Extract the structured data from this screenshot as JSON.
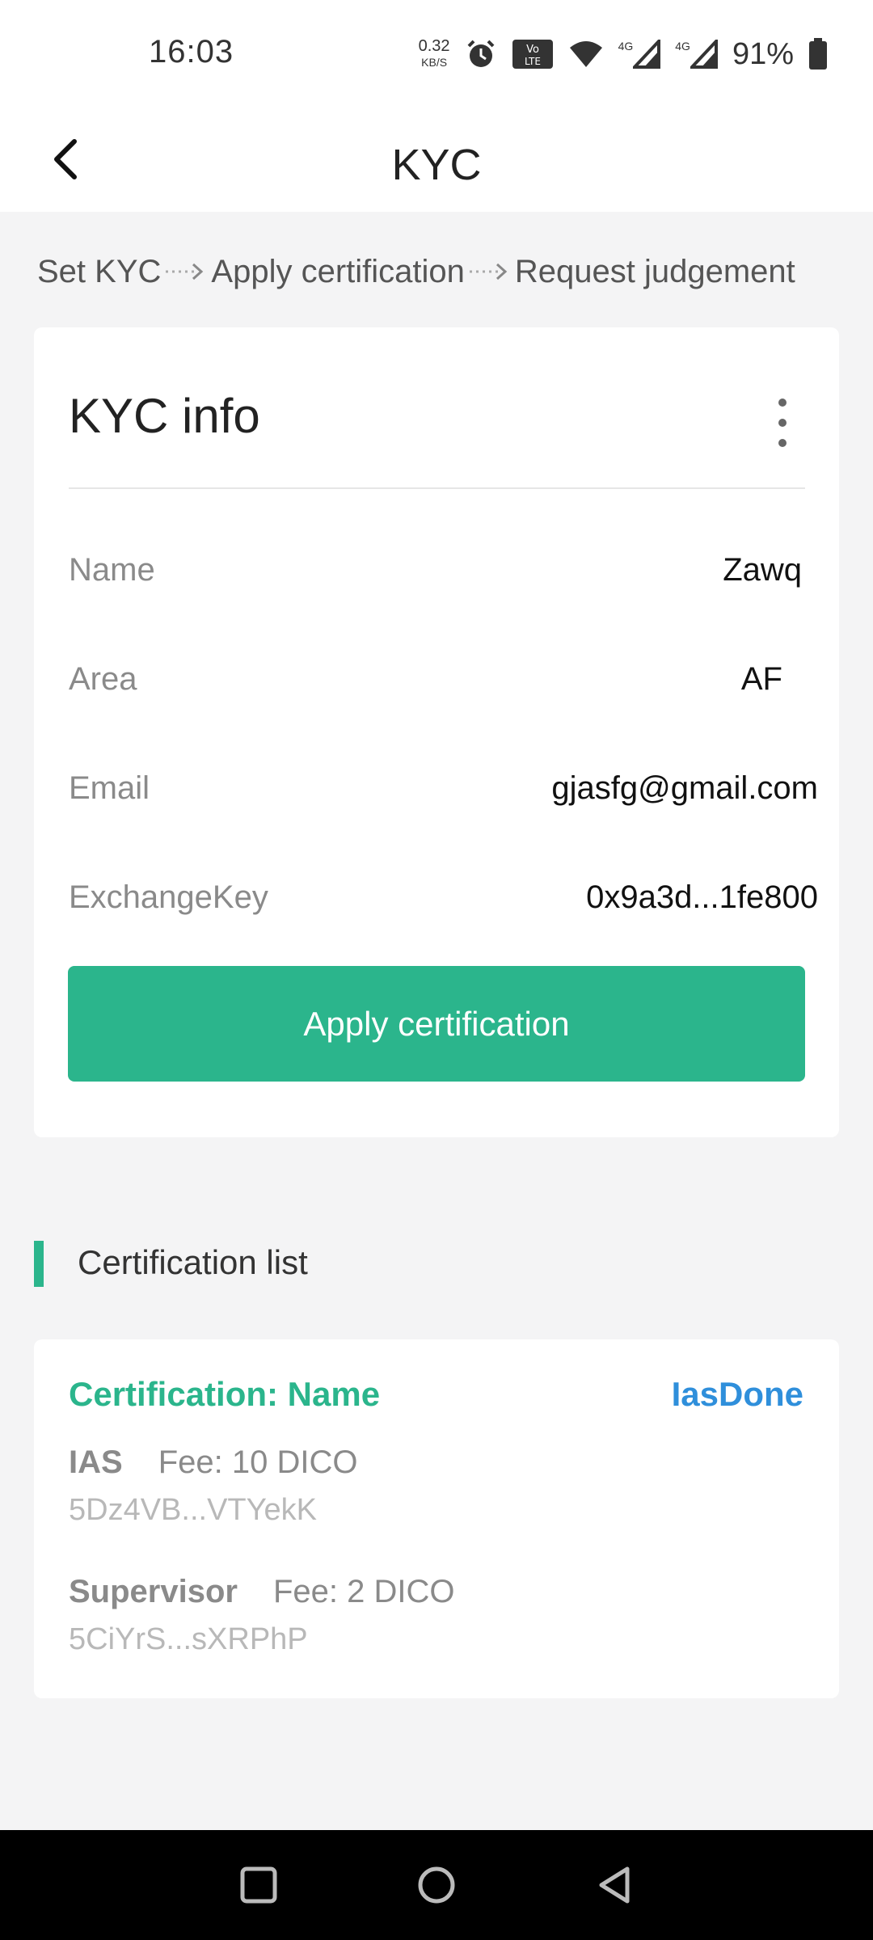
{
  "status_bar": {
    "time": "16:03",
    "net_speed_value": "0.32",
    "net_speed_unit": "KB/S",
    "signal_1": "4G",
    "signal_2": "4G",
    "battery_percent": "91%"
  },
  "app_bar": {
    "title": "KYC"
  },
  "steps": [
    "Set KYC",
    "Apply certification",
    "Request judgement"
  ],
  "kyc_card": {
    "title": "KYC info",
    "rows": [
      {
        "label": "Name",
        "value": "Zawq"
      },
      {
        "label": "Area",
        "value": "AF"
      },
      {
        "label": "Email",
        "value": "gjasfg@gmail.com"
      },
      {
        "label": "ExchangeKey",
        "value": "0x9a3d...1fe800"
      }
    ],
    "button_label": "Apply certification"
  },
  "certification_list": {
    "section_title": "Certification list",
    "items": [
      {
        "title": "Certification: Name",
        "status": "IasDone",
        "ias_label": "IAS",
        "ias_fee": "Fee: 10 DICO",
        "ias_address": "5Dz4VB...VTYekK",
        "supervisor_label": "Supervisor",
        "supervisor_fee": "Fee: 2 DICO",
        "supervisor_address": "5CiYrS...sXRPhP"
      }
    ]
  },
  "colors": {
    "accent": "#2bb58c",
    "status_blue": "#2f8fdb",
    "background": "#f4f4f5"
  },
  "icons": {
    "back": "back-arrow-icon",
    "more": "more-vertical-icon",
    "nav_recent": "square-icon",
    "nav_home": "circle-icon",
    "nav_back": "triangle-back-icon"
  }
}
